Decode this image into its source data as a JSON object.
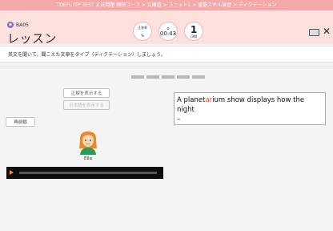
{
  "window": {
    "breadcrumb": "TOEFL ITP TEST 文法問題 弾回コース > 文構造 > ユニット1 > 重要スキル演習 > ディクテーション"
  },
  "header": {
    "lesson_code": "BA05",
    "title": "レッスン",
    "badges": [
      {
        "top": "正答率",
        "mid": "-",
        "bottom": "%"
      },
      {
        "top": "",
        "mid": "00:43",
        "bottom": ""
      },
      {
        "top": "",
        "mid": "1",
        "bottom": "/3問"
      }
    ]
  },
  "instruction": "英文を聞いて、聞こえた文章をタイプ（ディクテーション）しましょう。",
  "progress": {
    "total_segments": 5
  },
  "buttons": {
    "show_answer": "正解を表示する",
    "show_japanese": "日本語を表示する",
    "replay": "再前戦"
  },
  "answer_box": {
    "text_before": "A planet",
    "text_highlight": "ar",
    "text_after": "ium show displays how the night",
    "line2": "–"
  },
  "speaker": {
    "name": "Ella"
  },
  "player": {
    "progress": 0.0
  }
}
